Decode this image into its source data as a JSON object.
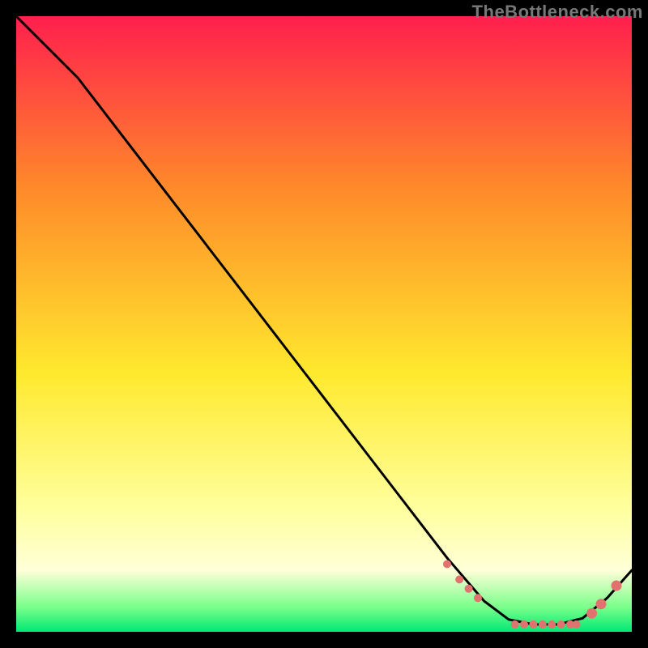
{
  "watermark": "TheBottleneck.com",
  "chart_data": {
    "type": "line",
    "title": "",
    "xlabel": "",
    "ylabel": "",
    "xlim": [
      0,
      100
    ],
    "ylim": [
      0,
      100
    ],
    "grid": false,
    "legend": false,
    "background_gradient": {
      "top": "#ff1f4e",
      "mid1": "#ff8a2a",
      "mid2": "#ffe92e",
      "low1": "#ffff9e",
      "low2": "#ffffd8",
      "bottom1": "#7aff8a",
      "bottom2": "#00e874"
    },
    "series": [
      {
        "name": "curve",
        "color": "#000000",
        "x": [
          0,
          6,
          10,
          20,
          30,
          40,
          50,
          60,
          70,
          76,
          80,
          84,
          88,
          92,
          96,
          100
        ],
        "y": [
          100,
          94,
          90,
          77,
          64,
          51,
          38,
          25,
          12,
          5,
          2,
          1.2,
          1.2,
          2.2,
          5.5,
          10
        ]
      }
    ],
    "dots": {
      "color": "#e2726f",
      "radius_small": 5,
      "radius_big": 6.5,
      "points": [
        {
          "x": 70,
          "y": 11
        },
        {
          "x": 72,
          "y": 8.5
        },
        {
          "x": 73.5,
          "y": 7
        },
        {
          "x": 75,
          "y": 5.5
        },
        {
          "x": 81,
          "y": 1.2
        },
        {
          "x": 82.5,
          "y": 1.2
        },
        {
          "x": 84,
          "y": 1.2
        },
        {
          "x": 85.5,
          "y": 1.2
        },
        {
          "x": 87,
          "y": 1.2
        },
        {
          "x": 88.5,
          "y": 1.2
        },
        {
          "x": 90,
          "y": 1.2
        },
        {
          "x": 91,
          "y": 1.2
        },
        {
          "x": 93.5,
          "y": 3.0,
          "big": true
        },
        {
          "x": 95,
          "y": 4.5,
          "big": true
        },
        {
          "x": 97.5,
          "y": 7.5,
          "big": true
        }
      ]
    }
  }
}
